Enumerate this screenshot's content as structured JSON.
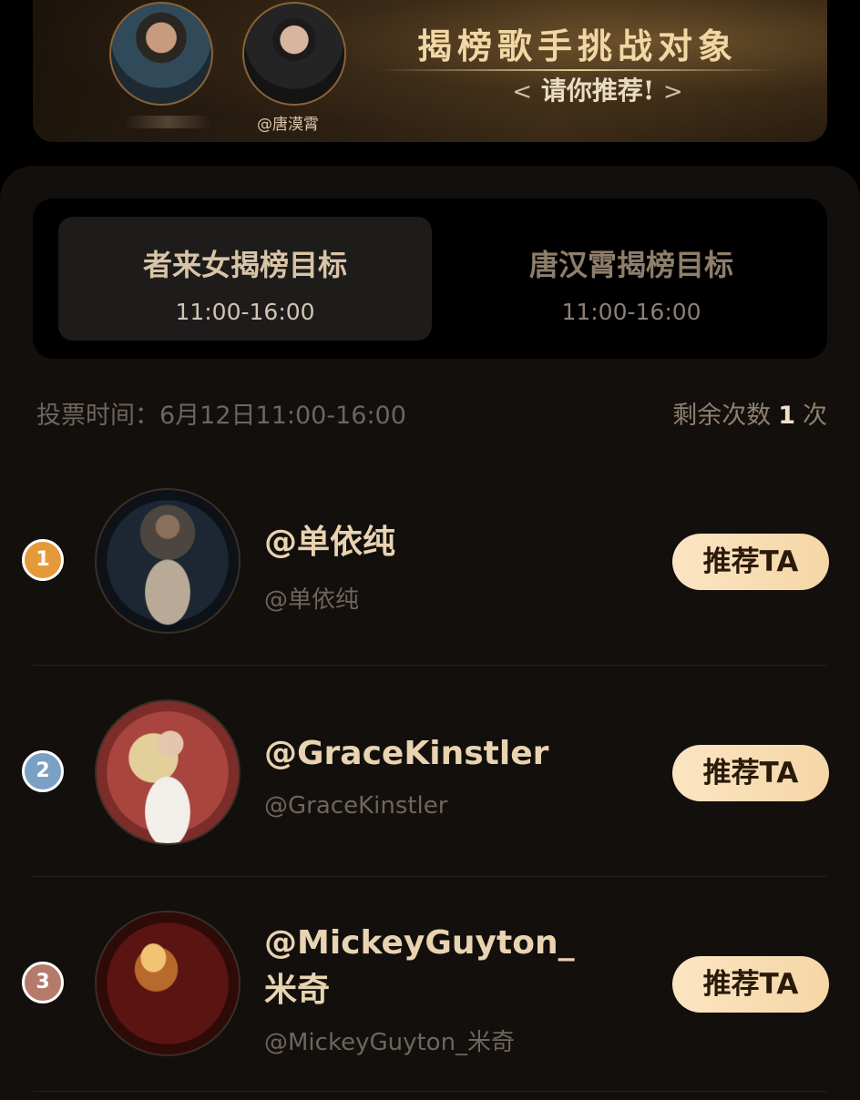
{
  "banner": {
    "title": "揭榜歌手挑战对象",
    "subtitle": "请你推荐!",
    "chevron_left": "<",
    "chevron_right": ">",
    "avatars": [
      {
        "caption": ""
      },
      {
        "caption": "@唐漠霄"
      }
    ]
  },
  "tabs": [
    {
      "title": "者来女揭榜目标",
      "time": "11:00-16:00",
      "active": true
    },
    {
      "title": "唐汉霄揭榜目标",
      "time": "11:00-16:00",
      "active": false
    }
  ],
  "vote_info": {
    "time_text": "投票时间：6月12日11:00-16:00",
    "remaining_prefix": "剩余次数",
    "remaining_count": "1",
    "remaining_suffix": "次"
  },
  "candidates": [
    {
      "rank": "1",
      "name": "@单依纯",
      "handle": "@单依纯",
      "button": "推荐TA"
    },
    {
      "rank": "2",
      "name": "@GraceKinstler",
      "handle": "@GraceKinstler",
      "button": "推荐TA"
    },
    {
      "rank": "3",
      "name": "@MickeyGuyton_米奇",
      "handle": "@MickeyGuyton_米奇",
      "button": "推荐TA"
    }
  ],
  "colors": {
    "accent_gold": "#e9d3b0",
    "button_bg": "#f5d6a6",
    "rank1": "#e59a3a",
    "rank2": "#7aa0c4",
    "rank3": "#b57a6a"
  }
}
